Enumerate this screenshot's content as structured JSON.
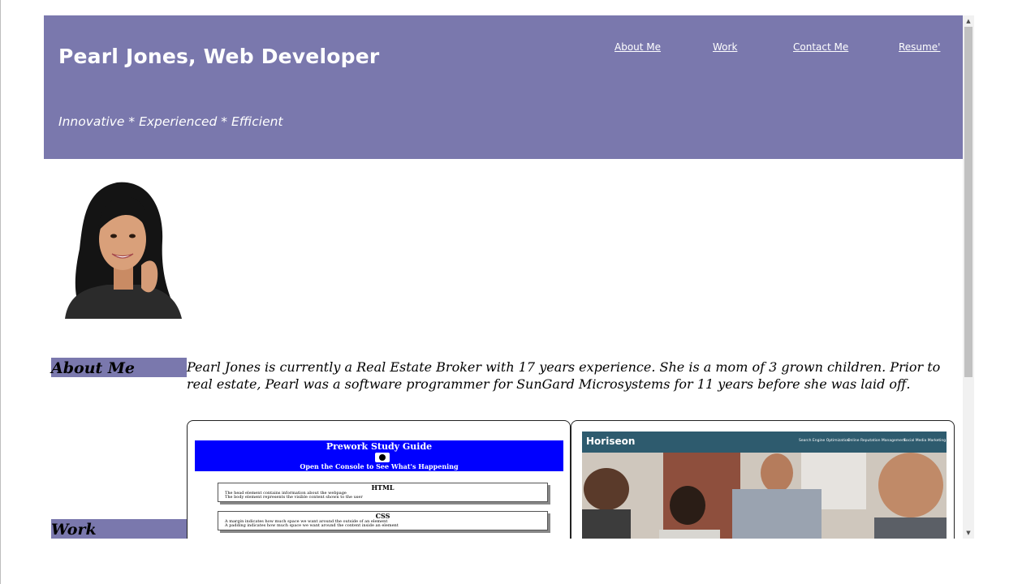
{
  "header": {
    "title": "Pearl Jones, Web Developer",
    "tagline": "Innovative * Experienced * Efficient",
    "nav": [
      {
        "label": "About Me"
      },
      {
        "label": "Work"
      },
      {
        "label": "Contact Me"
      },
      {
        "label": "Resume'"
      }
    ]
  },
  "about": {
    "heading": "About Me",
    "text": "Pearl Jones is currently a Real Estate Broker with 17 years experience. She is a mom of 3 grown children. Prior to real estate, Pearl was a software programmer for SunGard Microsystems for 11 years before she was laid off."
  },
  "work": {
    "heading": "Work",
    "cards": [
      {
        "title": "Prework Study Guide",
        "subtitle": "Open the Console to See What's Happening",
        "sections": [
          {
            "heading": "HTML",
            "lines": [
              "The head element contains information about the webpage",
              "The body element represents the visible content shown to the user"
            ]
          },
          {
            "heading": "CSS",
            "lines": [
              "A margin indicates how much space we want around the outside of an element",
              "A padding indicates how much space we want around the content inside an element"
            ]
          }
        ],
        "colors": {
          "banner": "#0000ff"
        }
      },
      {
        "brand": "Horiseon",
        "links": [
          "Search Engine Optimization",
          "Online Reputation Management",
          "Social Media Marketing"
        ],
        "colors": {
          "header": "#2e5b6e"
        }
      }
    ]
  },
  "colors": {
    "accent": "#7a78ad"
  },
  "scrollbar": {
    "icons": [
      "scroll-up-arrow",
      "scroll-down-arrow"
    ]
  }
}
